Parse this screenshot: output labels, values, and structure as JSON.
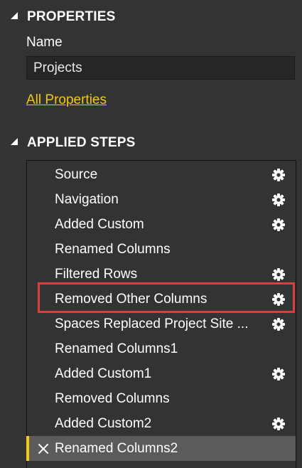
{
  "properties": {
    "title": "PROPERTIES",
    "name_label": "Name",
    "name_value": "Projects",
    "all_properties_link": "All Properties"
  },
  "applied_steps": {
    "title": "APPLIED STEPS",
    "steps": [
      {
        "label": "Source",
        "has_gear": true,
        "selected": false
      },
      {
        "label": "Navigation",
        "has_gear": true,
        "selected": false
      },
      {
        "label": "Added Custom",
        "has_gear": true,
        "selected": false
      },
      {
        "label": "Renamed Columns",
        "has_gear": false,
        "selected": false
      },
      {
        "label": "Filtered Rows",
        "has_gear": true,
        "selected": false
      },
      {
        "label": "Removed Other Columns",
        "has_gear": true,
        "selected": false,
        "highlighted": true
      },
      {
        "label": "Spaces Replaced Project Site ...",
        "has_gear": true,
        "selected": false
      },
      {
        "label": "Renamed Columns1",
        "has_gear": false,
        "selected": false
      },
      {
        "label": "Added Custom1",
        "has_gear": true,
        "selected": false
      },
      {
        "label": "Removed Columns",
        "has_gear": false,
        "selected": false
      },
      {
        "label": "Added Custom2",
        "has_gear": true,
        "selected": false
      },
      {
        "label": "Renamed Columns2",
        "has_gear": false,
        "selected": true
      }
    ]
  },
  "colors": {
    "background": "#333333",
    "link": "#f2c811",
    "selected_row": "#5b5b5b",
    "highlight_border": "#d9403a"
  },
  "icons": {
    "collapse": "triangle-collapse-icon",
    "step_settings": "gear-icon",
    "step_delete": "close-icon"
  }
}
